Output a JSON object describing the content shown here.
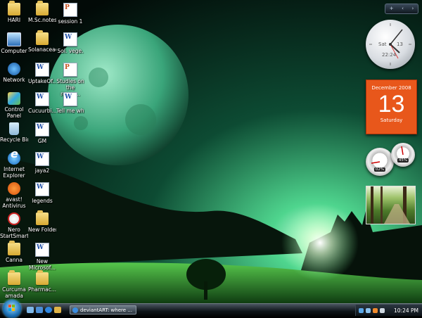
{
  "desktop": {
    "icons": [
      {
        "label": "HARI",
        "type": "folder"
      },
      {
        "label": "Computer",
        "type": "computer"
      },
      {
        "label": "Network",
        "type": "network"
      },
      {
        "label": "Control Panel",
        "type": "control-panel"
      },
      {
        "label": "Recycle Bin",
        "type": "recycle-bin"
      },
      {
        "label": "Internet Explorer",
        "type": "ie"
      },
      {
        "label": "avast! Antivirus",
        "type": "avast"
      },
      {
        "label": "Nero StartSmart",
        "type": "nero"
      },
      {
        "label": "Canna",
        "type": "folder"
      },
      {
        "label": "Curcuma amada",
        "type": "folder"
      },
      {
        "label": "M.Sc.notes",
        "type": "folder"
      },
      {
        "label": "Solanaceae",
        "type": "folder"
      },
      {
        "label": "UptakeOf...",
        "type": "word-doc"
      },
      {
        "label": "Cucuurbi...",
        "type": "word-doc"
      },
      {
        "label": "GM",
        "type": "word-doc"
      },
      {
        "label": "jaya2",
        "type": "word-doc"
      },
      {
        "label": "legends",
        "type": "word-doc"
      },
      {
        "label": "New Folder",
        "type": "folder"
      },
      {
        "label": "New Microsof...",
        "type": "word-doc"
      },
      {
        "label": "Pharmac...",
        "type": "folder"
      },
      {
        "label": "session 1",
        "type": "ppt-doc"
      },
      {
        "label": "Sol. vege.",
        "type": "word-doc"
      },
      {
        "label": "Studies on the respo...",
        "type": "ppt-doc"
      },
      {
        "label": "Tell me why",
        "type": "word-doc"
      }
    ]
  },
  "gadgets": {
    "clock": {
      "day_label": "Sat",
      "date_label": "13",
      "time_label": "22:24"
    },
    "calendar": {
      "month_year": "December 2008",
      "day_number": "13",
      "weekday": "Saturday"
    },
    "cpu_meter": {
      "cpu": "02%",
      "memory": "45%"
    },
    "sidebar_controls": {
      "add": "+",
      "prev": "‹",
      "next": "›"
    }
  },
  "taskbar": {
    "start_label": "Start",
    "task_title": "deviantART: where ...",
    "clock_time": "10:24 PM"
  },
  "colors": {
    "accent": "#e8571b",
    "sky": "#0f5a3b",
    "grass": "#2f8a2a"
  }
}
